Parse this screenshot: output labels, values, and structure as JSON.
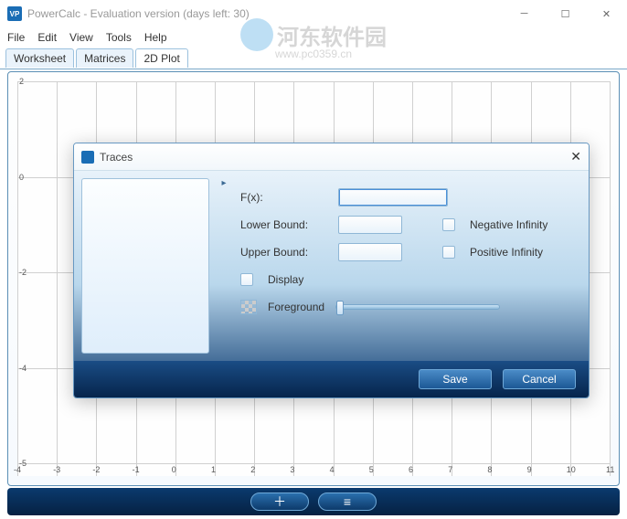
{
  "window": {
    "title": "PowerCalc - Evaluation version (days left: 30)",
    "app_icon": "VP"
  },
  "menu": {
    "items": [
      "File",
      "Edit",
      "View",
      "Tools",
      "Help"
    ]
  },
  "tabs": {
    "items": [
      "Worksheet",
      "Matrices",
      "2D Plot"
    ],
    "active_index": 2
  },
  "watermark": {
    "main": "河东软件园",
    "sub": "www.pc0359.cn"
  },
  "plot": {
    "x_ticks": [
      "-4",
      "-3",
      "-2",
      "-1",
      "0",
      "1",
      "2",
      "3",
      "4",
      "5",
      "6",
      "7",
      "8",
      "9",
      "10",
      "11"
    ],
    "y_ticks": [
      "2",
      "0",
      "-2",
      "-4",
      "-5"
    ]
  },
  "bottom": {
    "plus": "＋",
    "list": "≡"
  },
  "dialog": {
    "title": "Traces",
    "fields": {
      "fx_label": "F(x):",
      "lower_label": "Lower Bound:",
      "upper_label": "Upper Bound:",
      "neg_inf": "Negative Infinity",
      "pos_inf": "Positive Infinity",
      "display": "Display",
      "foreground": "Foreground",
      "fx_value": "",
      "lower_value": "",
      "upper_value": ""
    },
    "buttons": {
      "save": "Save",
      "cancel": "Cancel"
    }
  }
}
